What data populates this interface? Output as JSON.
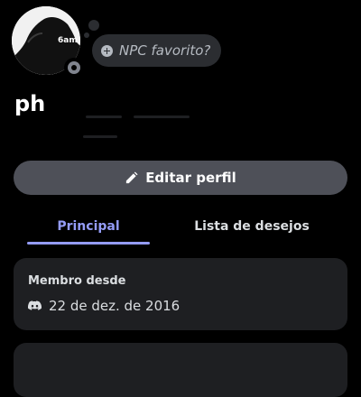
{
  "profile": {
    "username": "ph",
    "avatar_text": "6am",
    "status_placeholder": "NPC favorito?",
    "presence": "offline"
  },
  "actions": {
    "edit_profile_label": "Editar perfil",
    "edit_icon": "pencil-icon",
    "status_add_icon": "plus-circle-icon"
  },
  "tabs": [
    {
      "label": "Principal",
      "active": true
    },
    {
      "label": "Lista de desejos",
      "active": false
    }
  ],
  "member_since": {
    "title": "Membro desde",
    "date": "22 de dez. de 2016",
    "icon": "discord-icon"
  },
  "colors": {
    "background": "#000000",
    "accent": "#949cf7",
    "button": "#4e5058",
    "card": "#1e1f22"
  }
}
